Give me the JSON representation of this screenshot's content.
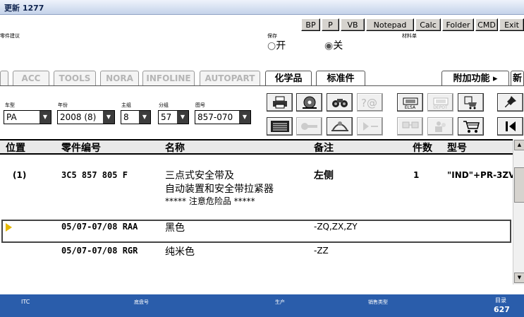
{
  "window": {
    "title": "更新 1277"
  },
  "toolbar": {
    "buttons": [
      "BP",
      "P",
      "VB",
      "Notepad",
      "Calc",
      "Folder",
      "CMD",
      "Exit"
    ]
  },
  "labels": {
    "part_suggestion": "零件建议",
    "save": "保存",
    "material_list": "材料单"
  },
  "radio": {
    "on": "开",
    "off": "关",
    "selected": "off"
  },
  "tabs": [
    "ACC",
    "TOOLS",
    "NORA",
    "INFOLINE",
    "AUTOPART",
    "化学品",
    "标准件"
  ],
  "extras": {
    "label": "附加功能",
    "arrow": "▸",
    "new": "新"
  },
  "filters": [
    {
      "label": "车型",
      "value": "PA"
    },
    {
      "label": "年份",
      "value": "2008 (8)"
    },
    {
      "label": "主组",
      "value": "8"
    },
    {
      "label": "分组",
      "value": "57"
    },
    {
      "label": "图号",
      "value": "857-070"
    }
  ],
  "tool_icons": {
    "elsa": "ELSA",
    "depot": "DEPOT",
    "icons": [
      "printer-icon",
      "disc-icon",
      "binoculars-icon",
      "query-icon",
      "elsa-icon",
      "depot-icon",
      "cart-person-icon",
      "pin-icon",
      "list-icon",
      "key-icon",
      "chassis-icon",
      "play-icon",
      "computers-icon",
      "people-icon",
      "cart-icon",
      "first-page-icon"
    ]
  },
  "table": {
    "headers": [
      "位置",
      "零件编号",
      "名称",
      "备注",
      "件数",
      "型号"
    ],
    "rows": [
      {
        "pos": "(1)",
        "part": "3C5 857 805 F",
        "name": [
          "三点式安全带及",
          "自动装置和安全带拉紧器",
          "***** 注意危险品 *****"
        ],
        "note": "左侧",
        "qty": "1",
        "model": "\"IND\"+PR-3ZV"
      },
      {
        "pos": "",
        "part": "05/07-07/08 RAA",
        "name": [
          "黑色"
        ],
        "note": "-ZQ,ZX,ZY",
        "qty": "",
        "model": ""
      },
      {
        "pos": "",
        "part": "05/07-07/08 RGR",
        "name": [
          "纯米色"
        ],
        "note": "-ZZ",
        "qty": "",
        "model": ""
      }
    ]
  },
  "status": {
    "itc": "ITC",
    "chassis": "底盘号",
    "production": "生产",
    "sales_type": "销售类型",
    "catalog_label": "目录",
    "catalog": "627"
  },
  "colors": {
    "statusbar": "#2a5dab",
    "pointer": "#e6b800"
  }
}
